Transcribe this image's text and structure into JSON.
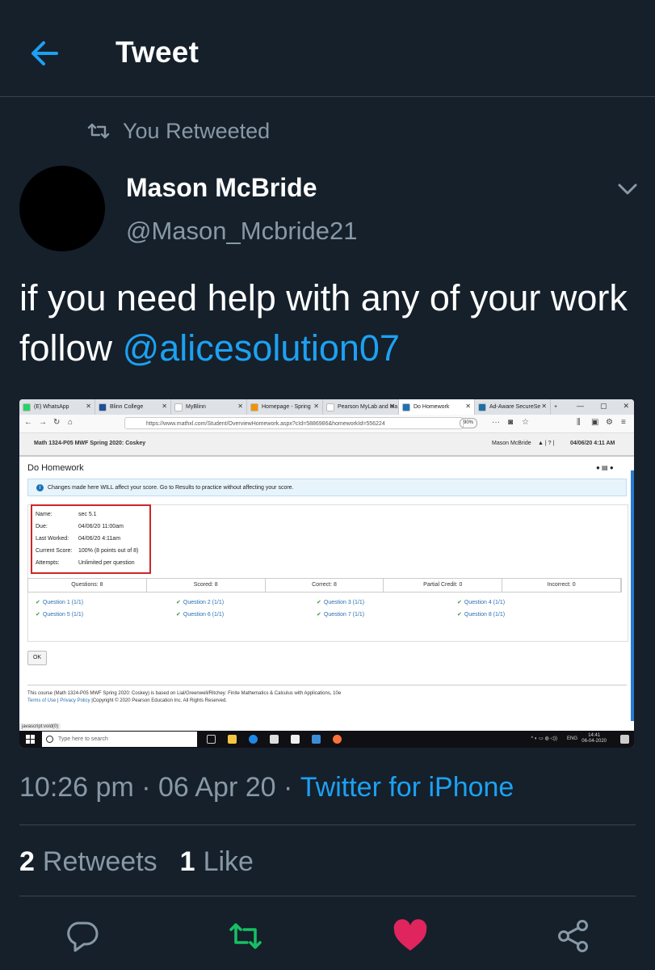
{
  "header": {
    "title": "Tweet",
    "back_icon": "arrow-left-icon"
  },
  "retweet_context": {
    "text": "You Retweeted",
    "icon": "retweet-icon"
  },
  "author": {
    "display_name": "Mason McBride",
    "handle": "@Mason_Mcbride21"
  },
  "tweet": {
    "text": "if you need help with any of your work follow ",
    "mention": "@alicesolution07"
  },
  "screenshot": {
    "browser_tabs": [
      {
        "label": "(E) WhatsApp",
        "color": "#25d366"
      },
      {
        "label": "Blinn College",
        "color": "#1f4e9a"
      },
      {
        "label": "MyBlinn",
        "color": "#ffffff"
      },
      {
        "label": "Homepage - Spring",
        "color": "#f29200"
      },
      {
        "label": "Pearson MyLab and Ma",
        "color": "#ffffff"
      },
      {
        "label": "Do Homework",
        "color": "#1a73b8"
      },
      {
        "label": "Ad-Aware SecureSe",
        "color": "#1d6fa8"
      }
    ],
    "url": "https://www.mathxl.com/Student/OverviewHomework.aspx?cId=5886986&homeworkId=556224",
    "zoom": "90%",
    "course_title": "Math 1324-P05 MWF Spring 2020: Coskey",
    "user_name": "Mason McBride",
    "date_time": "04/06/20 4:11 AM",
    "page_title": "Do Homework",
    "info_banner": "Changes made here WILL affect your score. Go to Results to practice without affecting your score.",
    "details": [
      {
        "label": "Name:",
        "value": "sec 5.1"
      },
      {
        "label": "Due:",
        "value": "04/06/20 11:00am"
      },
      {
        "label": "Last Worked:",
        "value": "04/06/20 4:11am"
      },
      {
        "label": "Current Score:",
        "value": "100% (8 points out of 8)"
      },
      {
        "label": "Attempts:",
        "value": "Unlimited per question"
      }
    ],
    "score_summary": [
      "Questions: 8",
      "Scored: 8",
      "Correct: 8",
      "Partial Credit: 0",
      "Incorrect: 0"
    ],
    "questions": [
      "Question 1 (1/1)",
      "Question 2 (1/1)",
      "Question 3 (1/1)",
      "Question 4 (1/1)",
      "Question 5 (1/1)",
      "Question 6 (1/1)",
      "Question 7 (1/1)",
      "Question 8 (1/1)"
    ],
    "ok_label": "OK",
    "footer_line1": "This course (Math 1324-P05 MWF Spring 2020: Coskey) is based on Lial/Greenwell/Ritchey: Finite Mathematics & Calculus with Applications, 10e",
    "footer_terms": "Terms of Use",
    "footer_privacy": "Privacy Policy",
    "footer_copyright": "Copyright © 2020 Pearson Education Inc. All Rights Reserved.",
    "status_text": "javascript:void(0)",
    "taskbar_search": "Type here to search",
    "tray_lang": "ENG",
    "tray_time": "14:41",
    "tray_date": "06-04-2020"
  },
  "meta": {
    "time": "10:26 pm",
    "date": "06 Apr 20",
    "source": "Twitter for iPhone"
  },
  "stats": {
    "retweets_count": "2",
    "retweets_label": "Retweets",
    "likes_count": "1",
    "likes_label": "Like"
  },
  "actions": {
    "reply_icon": "reply-icon",
    "retweet_icon": "retweet-icon",
    "like_icon": "heart-icon",
    "share_icon": "share-icon"
  },
  "colors": {
    "background": "#15202b",
    "accent": "#1da1f2",
    "muted": "#8899a6",
    "retweet_active": "#17bf63",
    "like_active": "#e0245e",
    "divider": "#38444d"
  }
}
